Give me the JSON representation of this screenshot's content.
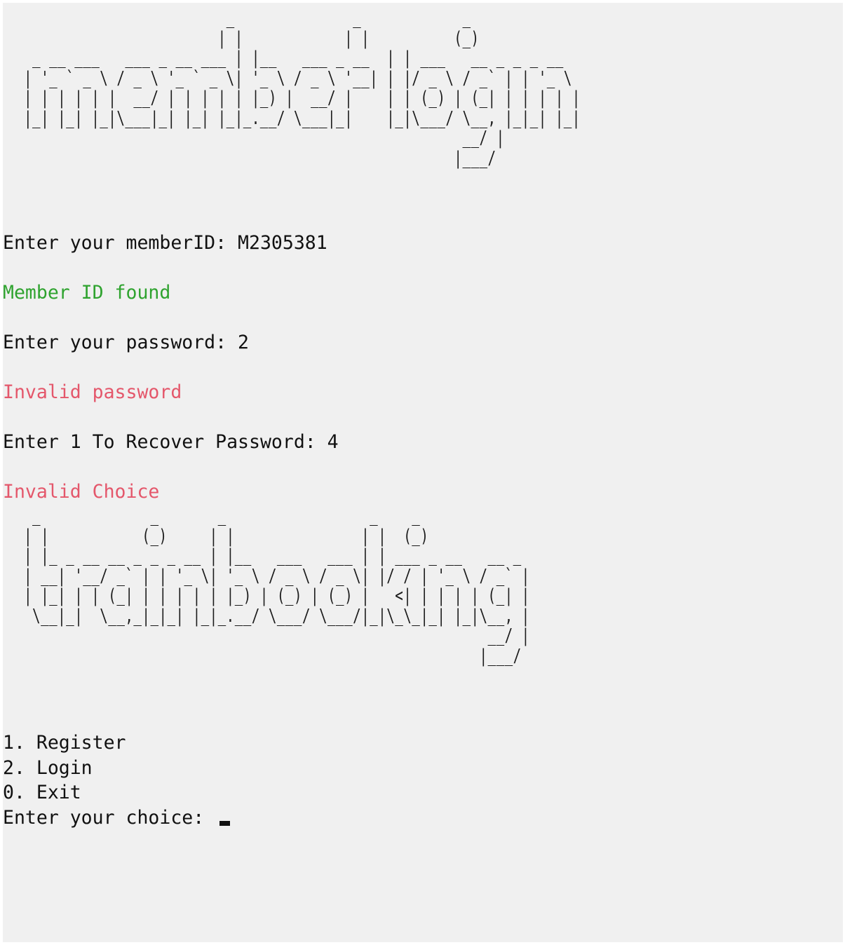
{
  "banners": {
    "member_login": "                         _              _            _ \n                        | |            | |          (_)\n  _ __ ___   ___ _ __ ___ | |__   ___ _ __  | | ___   __ _ _ _ __\n | '_ ` _ \\ / _ \\ '_ ` _ \\| '_ \\ / _ \\ '__| | |/ _ \\ / _` | | '_ \\\n | | | | | |  __/ | | | | | |_) |  __/ |    | | (_) | (_| | | | | |\n |_| |_| |_|\\___|_| |_| |_|_.__/ \\___|_|    |_|\\___/ \\__, |_|_| |_|\n                                                     __/ |\n                                                    |___/",
    "train_booking": "  _             _       _                 _    _\n | |           (_)     | |               | |  (_)\n | |_ _ __ __ _ _ _ __ | |__   ___   ___ | | ___ _ __   __ _\n | __| '__/ _` | | '_ \\| '_ \\ / _ \\ / _ \\| |/ / | '_ \\ / _` |\n | |_| | | (_| | | | | | |_) | (_) | (_) |   <| | | | | (_| |\n  \\__|_|  \\__,_|_|_| |_|_.__/ \\___/ \\___/|_|\\_\\_|_| |_|\\__, |\n                                                        __/ |\n                                                       |___/"
  },
  "session": {
    "member_id_prompt": "Enter your memberID: M2305381",
    "member_found": "Member ID found",
    "password_prompt": "Enter your password: 2",
    "invalid_password": "Invalid password",
    "recover_prompt": "Enter 1 To Recover Password: 4",
    "invalid_choice": "Invalid Choice"
  },
  "menu": {
    "items": [
      "1. Register",
      "2. Login",
      "0. Exit"
    ],
    "choice_prompt": "Enter your choice: "
  },
  "colors": {
    "background": "#f0f0f0",
    "text": "#111111",
    "success": "#2fa32f",
    "error": "#e4576b"
  }
}
